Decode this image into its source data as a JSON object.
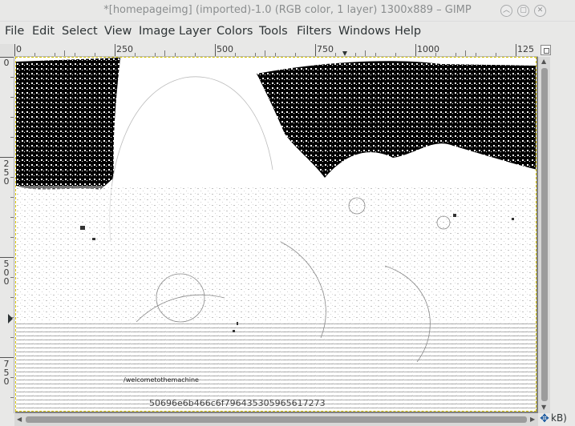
{
  "window": {
    "title": "*[homepageimg] (imported)-1.0 (RGB color, 1 layer) 1300x889 – GIMP",
    "minimize_icon": "minimize-icon",
    "maximize_icon": "maximize-icon",
    "close_icon": "close-icon"
  },
  "menubar": {
    "items": [
      "File",
      "Edit",
      "Select",
      "View",
      "Image",
      "Layer",
      "Colors",
      "Tools",
      "Filters",
      "Windows",
      "Help"
    ]
  },
  "ruler": {
    "horizontal": [
      "0",
      "250",
      "500",
      "750",
      "1000",
      "125"
    ],
    "vertical": [
      [
        "0"
      ],
      [
        "2",
        "5",
        "0"
      ],
      [
        "5",
        "0",
        "0"
      ],
      [
        "7",
        "5",
        "0"
      ]
    ]
  },
  "canvas": {
    "text_small": "/welcometothemachine",
    "text_hex": "50696e6b466c6f796435305965617273"
  },
  "statusbar": {
    "size_text": "kB)"
  },
  "colors": {
    "selection_border": "#d8c500",
    "canvas_background": "#808080"
  }
}
